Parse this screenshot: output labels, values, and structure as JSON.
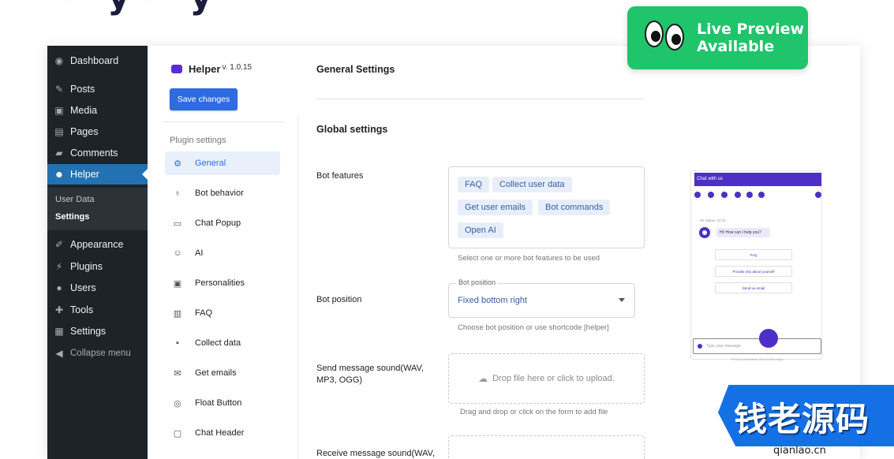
{
  "wp_menu": {
    "dashboard": "Dashboard",
    "posts": "Posts",
    "media": "Media",
    "pages": "Pages",
    "comments": "Comments",
    "helper": "Helper",
    "sub_user_data": "User Data",
    "sub_settings": "Settings",
    "appearance": "Appearance",
    "plugins": "Plugins",
    "users": "Users",
    "tools": "Tools",
    "settings": "Settings",
    "collapse": "Collapse menu"
  },
  "plugin": {
    "name": "Helper",
    "version": "v. 1.0.15",
    "save_label": "Save changes",
    "nav_caption": "Plugin settings",
    "nav": [
      "General",
      "Bot behavior",
      "Chat Popup",
      "AI",
      "Personalities",
      "FAQ",
      "Collect data",
      "Get emails",
      "Float Button",
      "Chat Header"
    ]
  },
  "content": {
    "title": "General Settings",
    "section": "Global settings",
    "bot_features_label": "Bot features",
    "features": [
      "FAQ",
      "Collect user data",
      "Get user emails",
      "Bot commands",
      "Open AI"
    ],
    "features_helper": "Select one or more bot features to be used",
    "bot_position_label": "Bot position",
    "bot_position_legend": "Bot position",
    "bot_position_value": "Fixed bottom right",
    "bot_position_helper": "Choose bot position or use shortcode [helper]",
    "send_sound_label": "Send message sound(WAV, MP3, OGG)",
    "drop_text": "Drop file here or click to upload.",
    "drop_helper": "Drag and drop or click on the form to add file",
    "receive_sound_label": "Receive message sound(WAV,"
  },
  "chat_preview": {
    "header": "Chat with us",
    "meta": "Mr Helper 12:34",
    "greeting": "Hi! How can I help you?",
    "options": [
      "FAQ",
      "Provide info about yourself",
      "Send us email"
    ],
    "input_placeholder": "Type your message",
    "footer": "Privacy information and cookie usage"
  },
  "badge": {
    "line1": "Live Preview",
    "line2": "Available"
  },
  "watermark": {
    "text": "钱老源码",
    "url": "qianlao.cn"
  },
  "colors": {
    "wp_sidebar": "#1d2327",
    "wp_active": "#2271b1",
    "primary": "#2f6be0",
    "chat_brand": "#4d2fc7",
    "badge": "#1fc46b"
  }
}
